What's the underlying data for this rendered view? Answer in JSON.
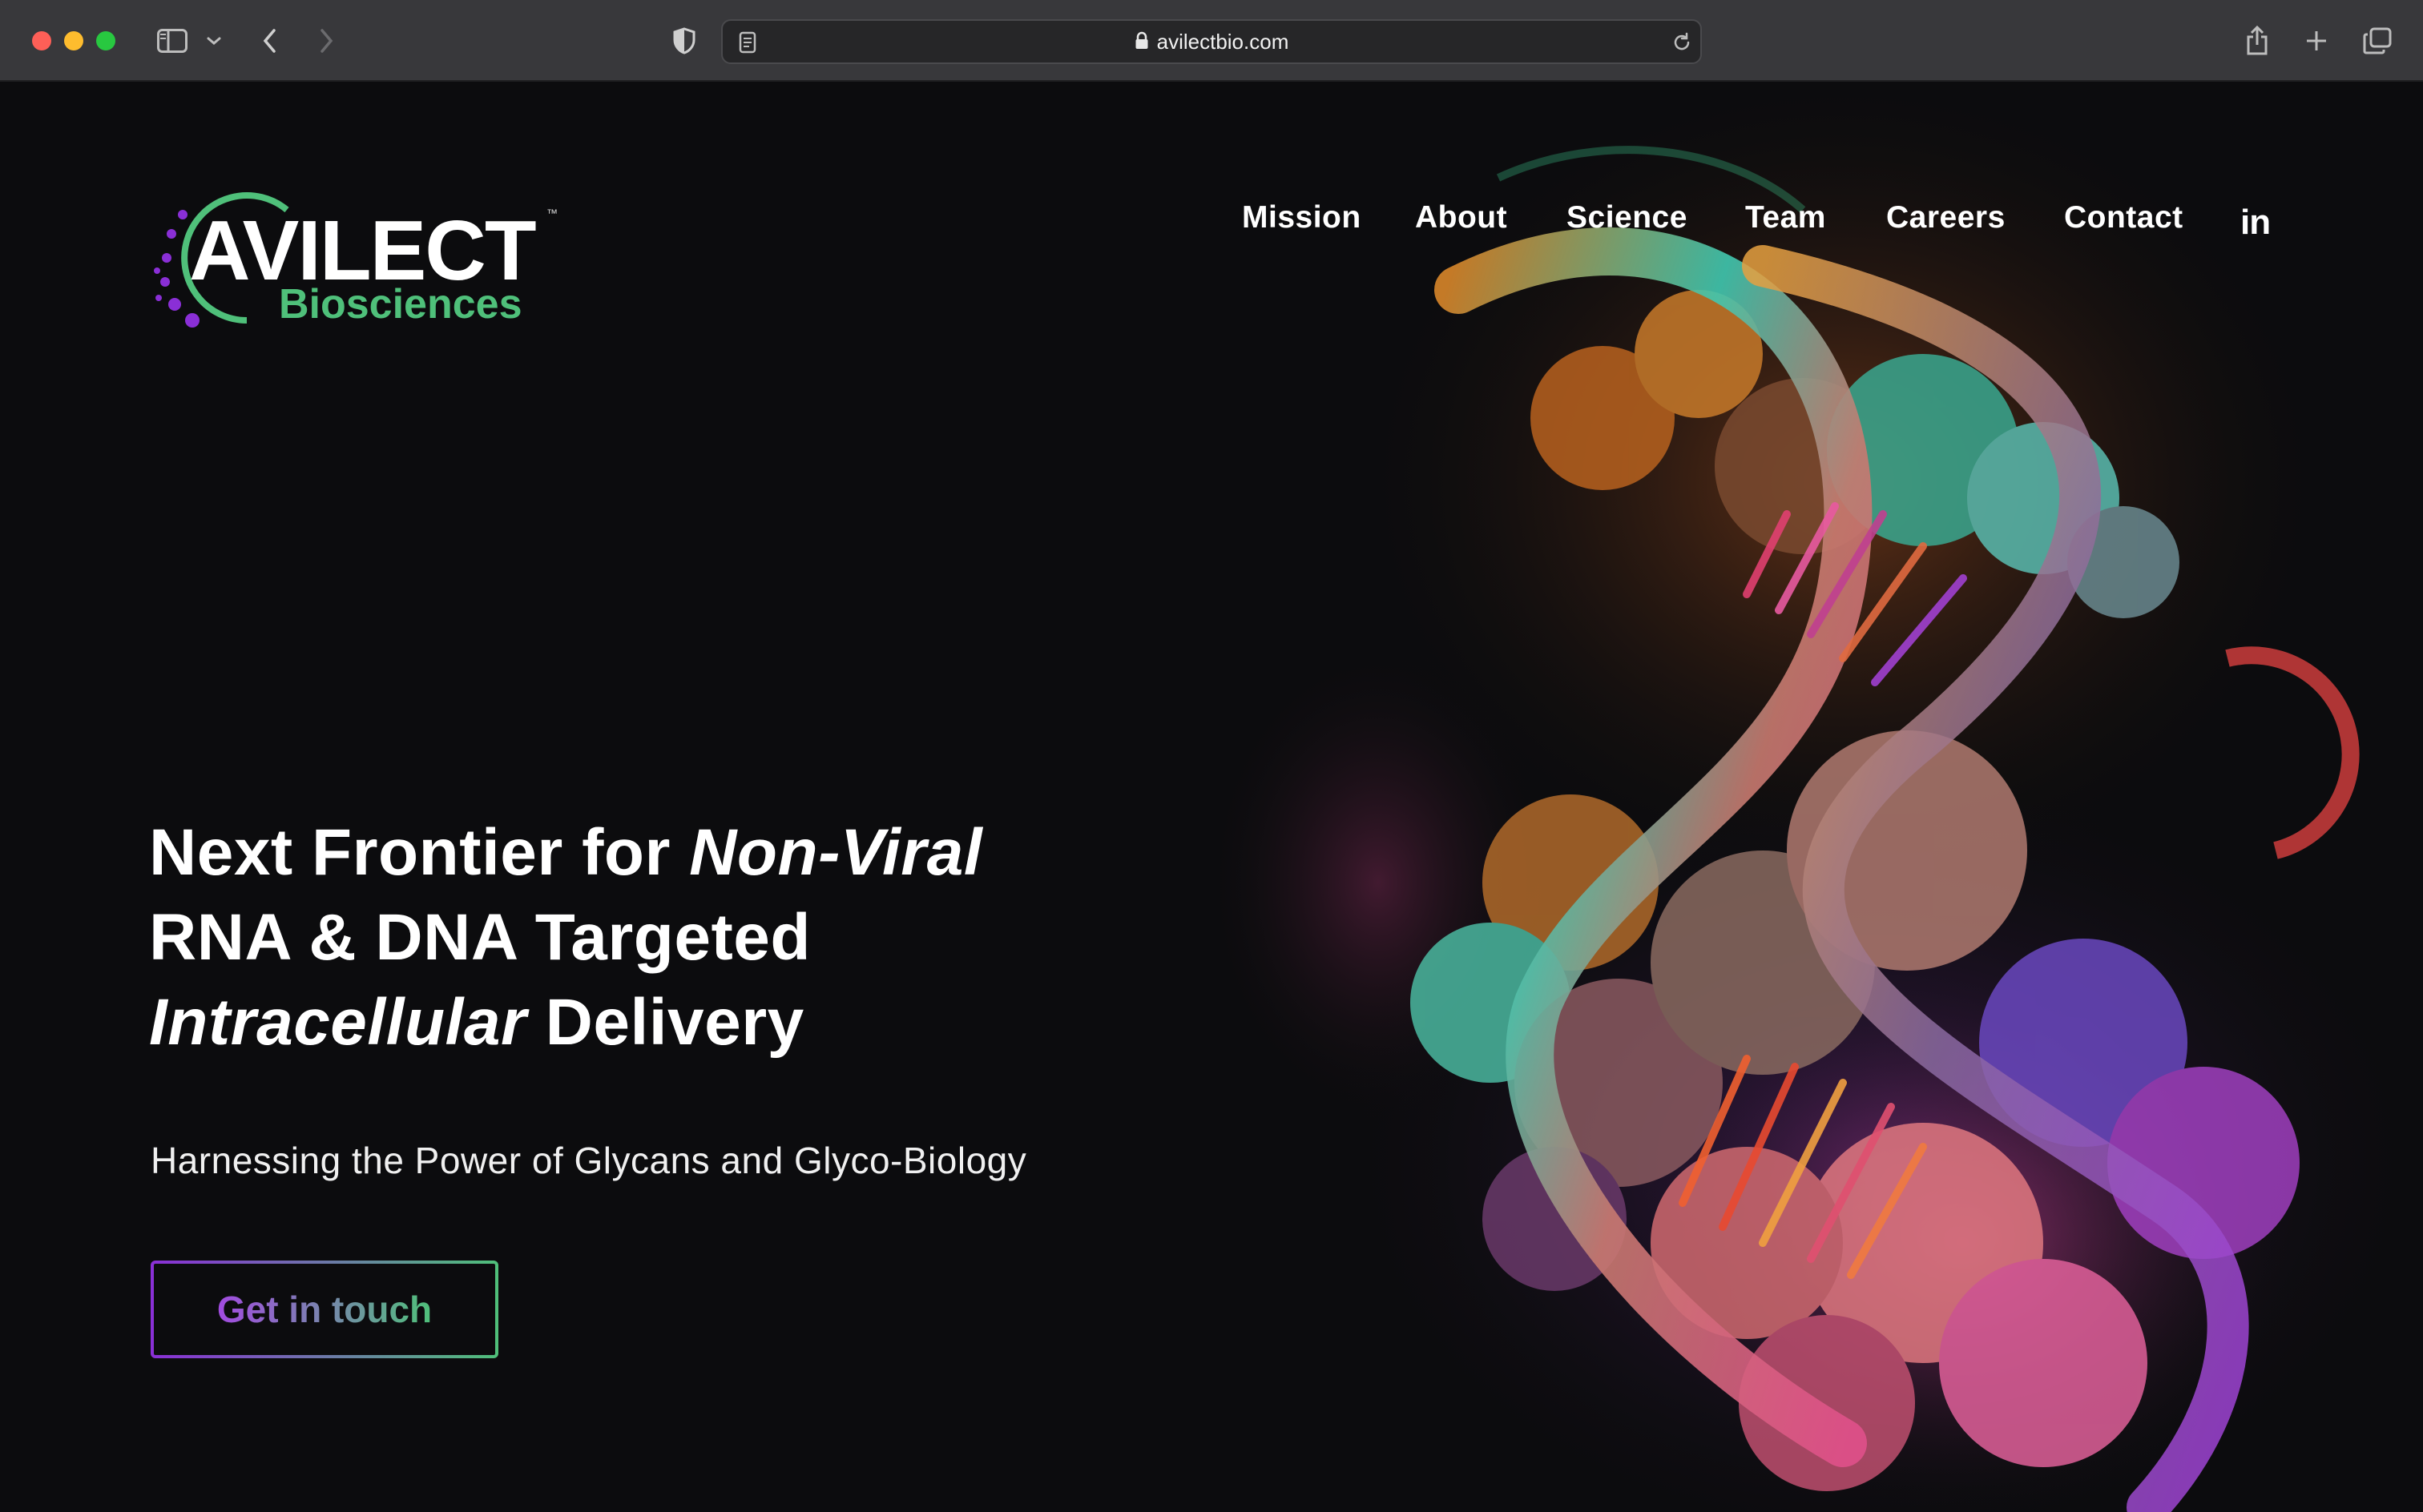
{
  "browser": {
    "url": "avilectbio.com",
    "icons": [
      "sidebar-icon",
      "chevron-down-icon",
      "back-icon",
      "forward-icon",
      "shield-icon",
      "reader-icon",
      "lock-icon",
      "reload-icon",
      "share-icon",
      "new-tab-icon",
      "tabs-overview-icon"
    ]
  },
  "site": {
    "logo": {
      "word": "AVILECT",
      "tm": "™",
      "sub": "Biosciences"
    },
    "nav": [
      "Mission",
      "About",
      "Science",
      "Team",
      "Careers",
      "Contact"
    ],
    "social": "in",
    "hero": {
      "line1_plain": "Next Frontier for ",
      "line1_italic": "Non-Viral",
      "line2": "RNA & DNA Targeted",
      "line3_italic": "Intracellular",
      "line3_plain": " Delivery",
      "subtitle": "Harnessing the Power of Glycans and Glyco-Biology",
      "cta": "Get in touch"
    },
    "colors": {
      "brand_green": "#4fc07a",
      "brand_purple": "#8a2fd6",
      "background": "#0c0c0e"
    }
  }
}
